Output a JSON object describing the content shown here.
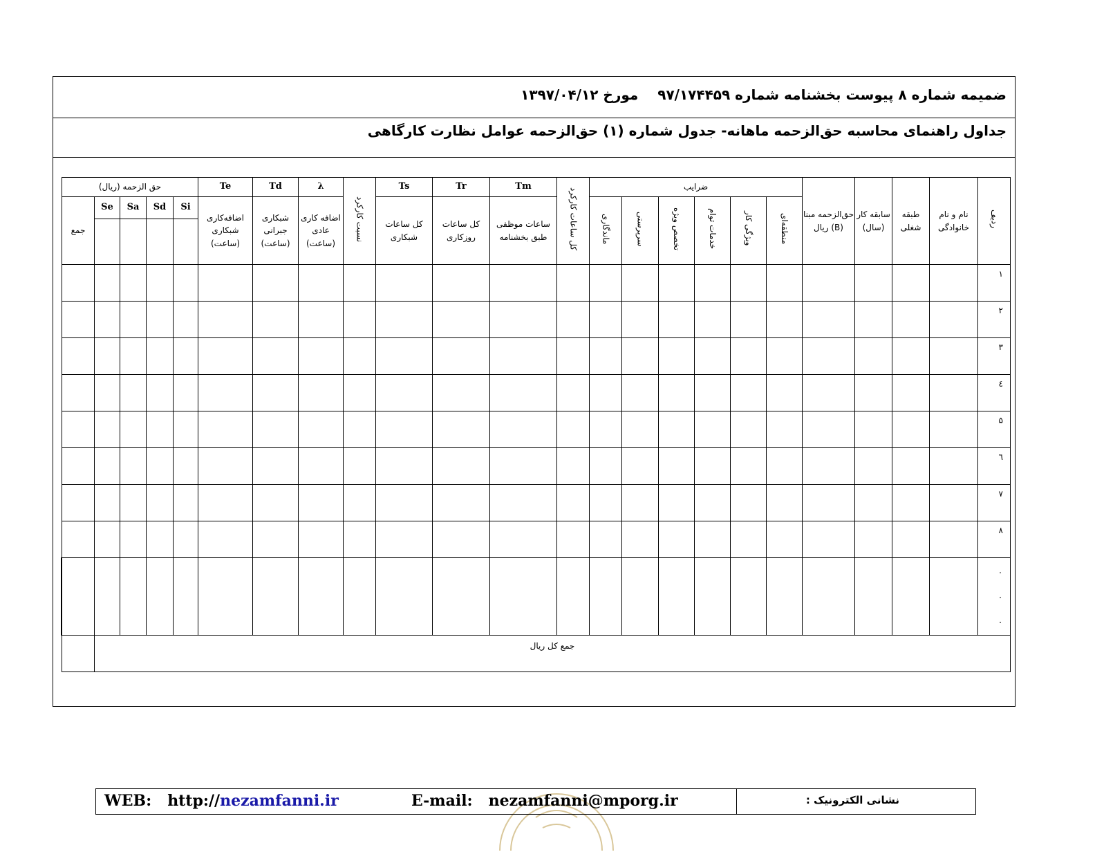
{
  "header": {
    "line1_part1": "ضمیمه شماره ۸ پیوست بخشنامه شماره ۹۷/۱۷۴۴۵۹",
    "line1_part2": "مورخ ۱۳۹۷/۰۴/۱۲",
    "line2": "جداول راهنمای محاسبه حق‌الزحمه ماهانه- جدول شماره (۱) حق‌الزحمه عوامل نظارت کارگاهی"
  },
  "table": {
    "groups": {
      "coefficients": "ضرایب",
      "fee_rial": "حق الزحمه (ریال)"
    },
    "symbols": {
      "tm": "Tm",
      "tr": "Tr",
      "ts": "Ts",
      "lambda": "λ",
      "td": "Td",
      "te": "Te",
      "si": "Si",
      "sd": "Sd",
      "sa": "Sa",
      "se": "Se"
    },
    "columns": {
      "row": "ردیف",
      "name": "نام و نام خانوادگی",
      "job_class": "طبقه شغلی",
      "experience": "سابقه کار (سال)",
      "base_fee": "حق‌الزحمه مبنا (B) ریال",
      "regional": "منطقه‌ای",
      "work_feature": "ویژگی کار",
      "combined_services": "خدمات توام",
      "special_expertise": "تخصص ویژه",
      "supervision": "سرپرستی",
      "duration": "ماندگاری",
      "total_work_hours": "کل ساعات کارکرد",
      "required_hours": "ساعات موظفی طبق بخشنامه",
      "total_day_hours": "کل ساعات روزکاری",
      "total_night_hours": "کل ساعات شبکاری",
      "work_ratio": "نسبت کارکرد",
      "overtime_regular": "اضافه کاری عادی (ساعت)",
      "night_compensatory": "شبکاری جبرانی (ساعت)",
      "overtime_night": "اضافه‌کاری شبکاری (ساعت)",
      "sum": "جمع"
    },
    "row_numbers": [
      "۱",
      "۲",
      "۳",
      "٤",
      "۵",
      "٦",
      "۷",
      "۸"
    ],
    "ellipsis": [
      ".",
      ".",
      "."
    ],
    "total_label": "جمع کل ریال"
  },
  "footer": {
    "web_label": "WEB:",
    "web_prefix": "http://",
    "web_domain": "nezamfanni.ir",
    "email_label": "E-mail:",
    "email_value": "nezamfanni@mporg.ir",
    "address_label": "نشانی الکترونیک :"
  },
  "colors": {
    "link": "#1a1aa8",
    "seal": "#d9c79a"
  }
}
